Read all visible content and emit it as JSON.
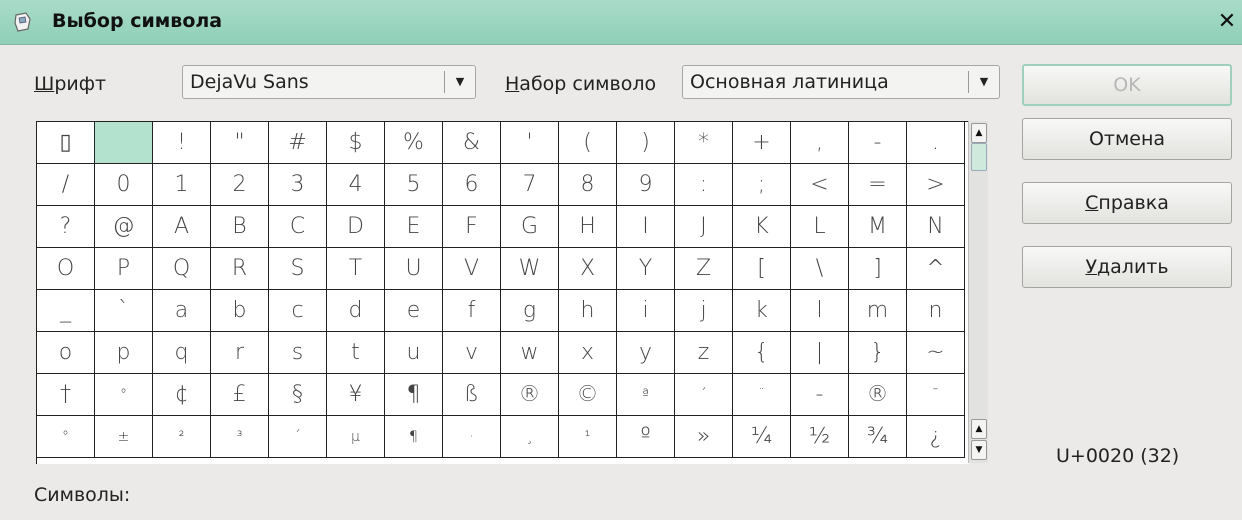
{
  "window": {
    "title": "Выбор символа",
    "close_glyph": "✕"
  },
  "font": {
    "label_mn": "Ш",
    "label_rest": "рифт",
    "value": "DejaVu Sans"
  },
  "subset": {
    "label_mn": "Н",
    "label_rest": "абор символо",
    "value": "Основная латиница"
  },
  "buttons": {
    "ok": "OK",
    "cancel": "Отмена",
    "help_mn": "С",
    "help_rest": "правка",
    "delete_mn": "У",
    "delete_rest": "далить"
  },
  "characters": [
    "▯",
    "",
    "!",
    "\"",
    "#",
    "$",
    "%",
    "&",
    "'",
    "(",
    ")",
    "*",
    "+",
    ",",
    "-",
    ".",
    "/",
    "0",
    "1",
    "2",
    "3",
    "4",
    "5",
    "6",
    "7",
    "8",
    "9",
    ":",
    ";",
    "<",
    "=",
    ">",
    "?",
    "@",
    "A",
    "B",
    "C",
    "D",
    "E",
    "F",
    "G",
    "H",
    "I",
    "J",
    "K",
    "L",
    "M",
    "N",
    "O",
    "P",
    "Q",
    "R",
    "S",
    "T",
    "U",
    "V",
    "W",
    "X",
    "Y",
    "Z",
    "[",
    "\\",
    "]",
    "^",
    "_",
    "`",
    "a",
    "b",
    "c",
    "d",
    "e",
    "f",
    "g",
    "h",
    "i",
    "j",
    "k",
    "l",
    "m",
    "n",
    "o",
    "p",
    "q",
    "r",
    "s",
    "t",
    "u",
    "v",
    "w",
    "x",
    "y",
    "z",
    "{",
    "|",
    "}",
    "~",
    "†",
    "°",
    "¢",
    "£",
    "§",
    "¥",
    "¶",
    "ß",
    "®",
    "©",
    "ª",
    "´",
    "¨",
    "-",
    "®",
    "¯",
    "°",
    "±",
    "²",
    "³",
    "´",
    "µ",
    "¶",
    "·",
    "¸",
    "¹",
    "º",
    "»",
    "¼",
    "½",
    "¾",
    "¿"
  ],
  "selected_index": 1,
  "code_point": "U+0020 (32)",
  "symbols_label": "Символы:"
}
